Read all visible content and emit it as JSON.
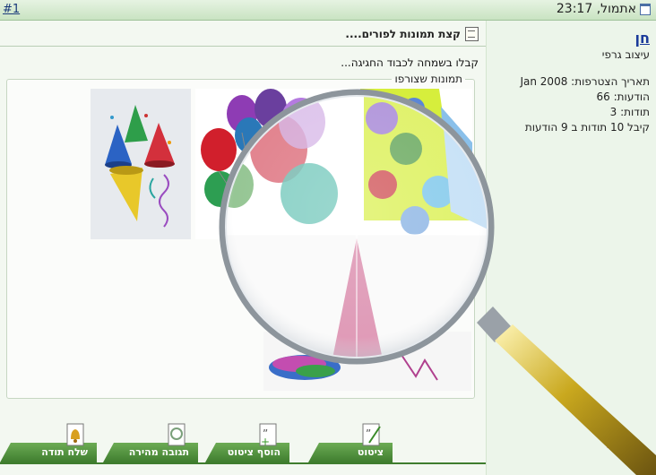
{
  "header": {
    "post_number": "#1",
    "date": "אתמול, 23:17"
  },
  "post": {
    "subject": "קצת תמונות לפורים....",
    "body": "קבלו בשמחה לכבוד החגיגה...",
    "attachments_legend": "תמונות שצורפו"
  },
  "user": {
    "name": "חן",
    "rank": "עיצוב גרפי",
    "join_date": "תאריך הצטרפות: Jan 2008",
    "posts": "הודעות: 66",
    "thanks": "תודות: 3",
    "thanked": "קיבל 10 תודות ב 9 הודעות"
  },
  "buttons": {
    "quote": "ציטוט",
    "multi_quote": "הוסף ציטוט",
    "quick_reply": "תגובה מהירה",
    "thanks": "שלח תודה"
  },
  "icons": [
    "document-icon",
    "note-icon",
    "magnifier-icon",
    "quote-icon",
    "plus-quote-icon",
    "quick-reply-icon",
    "bell-icon"
  ],
  "colors": {
    "accent": "#3f7d2e",
    "header_bg": "#c9e3c2",
    "link": "#1a3a9a"
  }
}
